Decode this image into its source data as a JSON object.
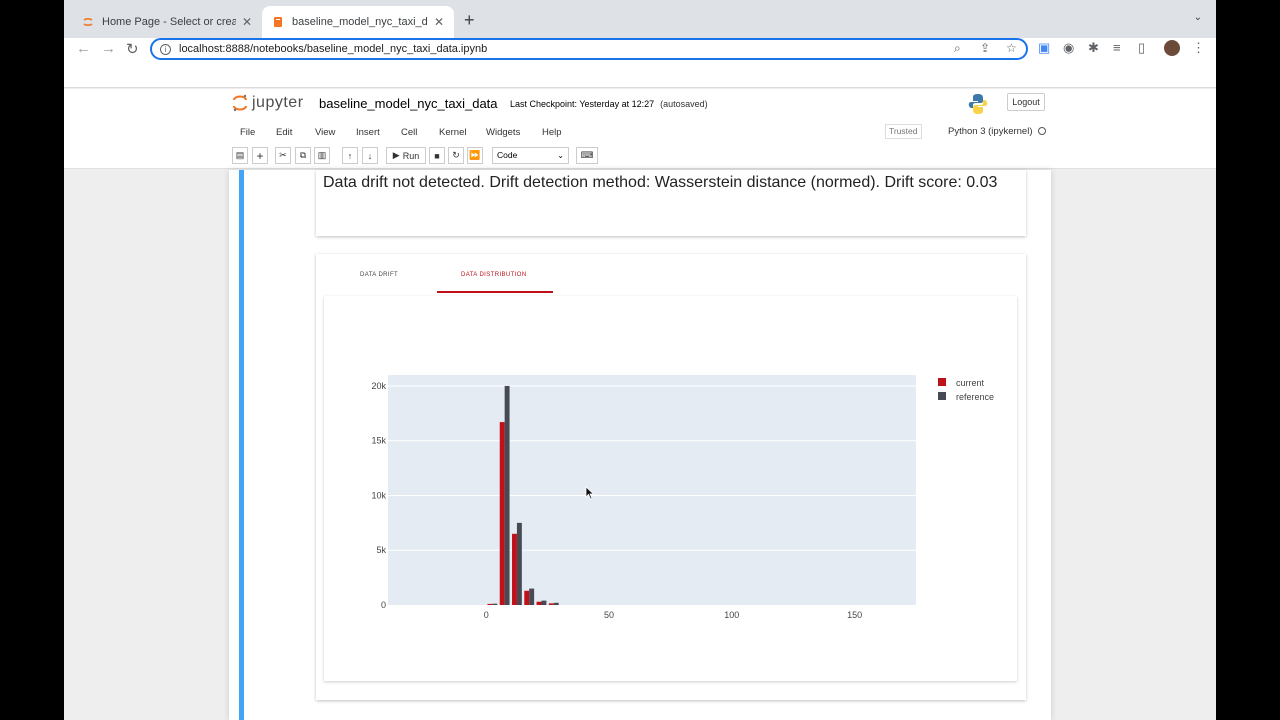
{
  "browser": {
    "tabs": [
      {
        "title": "Home Page - Select or create a notebook"
      },
      {
        "title": "baseline_model_nyc_taxi_data.ipynb"
      }
    ],
    "url": "localhost:8888/notebooks/baseline_model_nyc_taxi_data.ipynb"
  },
  "jupyter": {
    "logo_text": "jupyter",
    "notebook_name": "baseline_model_nyc_taxi_data",
    "checkpoint": "Last Checkpoint: Yesterday at 12:27",
    "autosave": "(autosaved)",
    "logout": "Logout",
    "menus": [
      "File",
      "Edit",
      "View",
      "Insert",
      "Cell",
      "Kernel",
      "Widgets",
      "Help"
    ],
    "trusted": "Trusted",
    "kernel": "Python 3 (ipykernel)",
    "run_label": "Run",
    "cell_type": "Code"
  },
  "output": {
    "drift_text": "Data drift not detected. Drift detection method: Wasserstein distance (normed). Drift score: 0.03",
    "tabs": [
      "DATA DRIFT",
      "DATA DISTRIBUTION"
    ]
  },
  "colors": {
    "current": "#c0101a",
    "reference": "#474a52",
    "plot_bg": "#e4ebf3",
    "accent": "#42a5f5"
  },
  "chart_data": {
    "type": "bar",
    "x": [
      -5,
      0,
      5,
      10,
      15,
      20,
      25,
      30,
      35,
      40
    ],
    "series": [
      {
        "name": "current",
        "values": [
          0,
          100,
          16700,
          6500,
          1300,
          300,
          150,
          0,
          0,
          0
        ]
      },
      {
        "name": "reference",
        "values": [
          0,
          120,
          20000,
          7500,
          1500,
          400,
          200,
          0,
          0,
          0
        ]
      }
    ],
    "bin_width": 5,
    "xlim": [
      -40,
      175
    ],
    "ylim": [
      0,
      21000
    ],
    "xticks": [
      0,
      50,
      100,
      150
    ],
    "yticks": [
      0,
      5000,
      10000,
      15000,
      20000
    ],
    "xtick_labels": [
      "0",
      "50",
      "100",
      "150"
    ],
    "ytick_labels": [
      "0",
      "5k",
      "10k",
      "15k",
      "20k"
    ],
    "legend_position": "top-right",
    "grid": true
  }
}
